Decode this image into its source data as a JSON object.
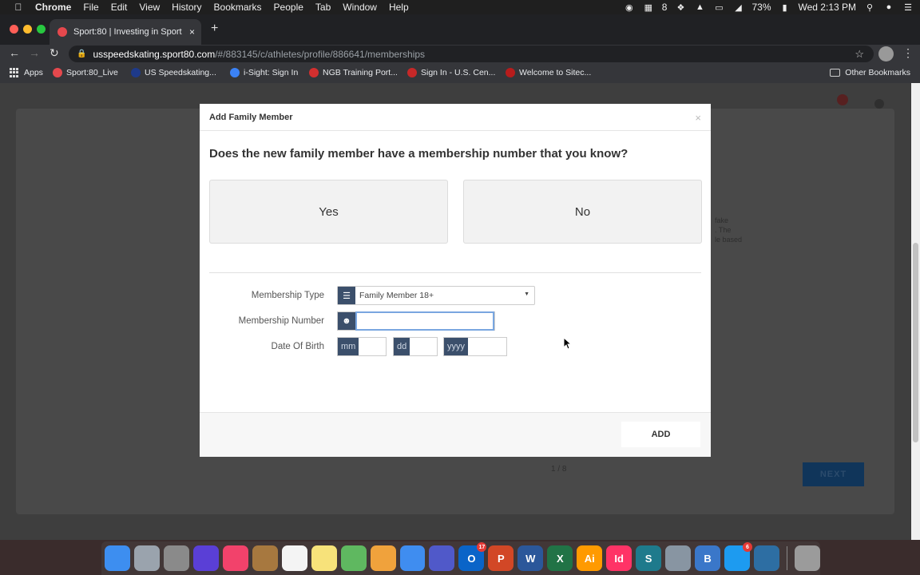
{
  "menubar": {
    "app": "Chrome",
    "items": [
      "File",
      "Edit",
      "View",
      "History",
      "Bookmarks",
      "People",
      "Tab",
      "Window",
      "Help"
    ],
    "notification_count": "8",
    "battery": "73%",
    "clock": "Wed 2:13 PM"
  },
  "browser": {
    "tab_title": "Sport:80 | Investing in Sport",
    "url_host": "usspeedskating.sport80.com",
    "url_path": "/#/883145/c/athletes/profile/886641/memberships",
    "bookmarks": [
      {
        "label": "Apps",
        "color": "#dddddd"
      },
      {
        "label": "Sport:80_Live",
        "color": "#e5484d"
      },
      {
        "label": "US Speedskating...",
        "color": "#1e3a8a"
      },
      {
        "label": "i-Sight: Sign In",
        "color": "#3b82f6"
      },
      {
        "label": "NGB Training Port...",
        "color": "#d32f2f"
      },
      {
        "label": "Sign In - U.S. Cen...",
        "color": "#c62828"
      },
      {
        "label": "Welcome to Sitec...",
        "color": "#b71c1c"
      }
    ],
    "other_bookmarks": "Other Bookmarks"
  },
  "background_page": {
    "next_label": "NEXT",
    "partial_text": [
      "fake",
      ". The",
      "le based"
    ],
    "pagination": "1 / 8"
  },
  "modal": {
    "title": "Add Family Member",
    "close_glyph": "×",
    "question": "Does the new family member have a membership number that you know?",
    "yes_label": "Yes",
    "no_label": "No",
    "membership_type_label": "Membership Type",
    "membership_type_value": "Family Member 18+",
    "membership_number_label": "Membership Number",
    "membership_number_value": "",
    "dob_label": "Date Of Birth",
    "dob_mm": "mm",
    "dob_dd": "dd",
    "dob_yyyy": "yyyy",
    "add_label": "ADD"
  },
  "dock": {
    "apps": [
      {
        "name": "finder-icon",
        "color": "#3d8ef0",
        "glyph": ""
      },
      {
        "name": "launchpad-icon",
        "color": "#9aa3ad",
        "glyph": ""
      },
      {
        "name": "system-preferences-icon",
        "color": "#8a8a8a",
        "glyph": ""
      },
      {
        "name": "siri-icon",
        "color": "#5a3fd6",
        "glyph": ""
      },
      {
        "name": "music-icon",
        "color": "#f2426b",
        "glyph": ""
      },
      {
        "name": "notefile-icon",
        "color": "#a7783f",
        "glyph": ""
      },
      {
        "name": "textedit-icon",
        "color": "#f4f4f4",
        "glyph": ""
      },
      {
        "name": "notes-icon",
        "color": "#f7e27a",
        "glyph": ""
      },
      {
        "name": "maps-icon",
        "color": "#5fb860",
        "glyph": ""
      },
      {
        "name": "photos-icon",
        "color": "#f0a23c",
        "glyph": ""
      },
      {
        "name": "chrome-icon",
        "color": "#3f8df0",
        "glyph": ""
      },
      {
        "name": "teams-icon",
        "color": "#5059c9",
        "glyph": ""
      },
      {
        "name": "outlook-icon",
        "color": "#0a64c8",
        "glyph": "O",
        "badge": "17"
      },
      {
        "name": "powerpoint-icon",
        "color": "#d24726",
        "glyph": "P"
      },
      {
        "name": "word-icon",
        "color": "#2b579a",
        "glyph": "W"
      },
      {
        "name": "excel-icon",
        "color": "#217346",
        "glyph": "X"
      },
      {
        "name": "illustrator-icon",
        "color": "#ff9a00",
        "glyph": "Ai"
      },
      {
        "name": "indesign-icon",
        "color": "#ff3366",
        "glyph": "Id"
      },
      {
        "name": "sway-icon",
        "color": "#1e7a8c",
        "glyph": "S"
      },
      {
        "name": "scanner-icon",
        "color": "#8895a2",
        "glyph": ""
      },
      {
        "name": "bbedit-icon",
        "color": "#3a77c9",
        "glyph": "B"
      },
      {
        "name": "app-store-icon",
        "color": "#1d9bf0",
        "glyph": "",
        "badge": "6"
      },
      {
        "name": "network-icon",
        "color": "#2d6ea3",
        "glyph": ""
      },
      {
        "name": "trash-icon",
        "color": "#9b9b9b",
        "glyph": ""
      }
    ]
  }
}
